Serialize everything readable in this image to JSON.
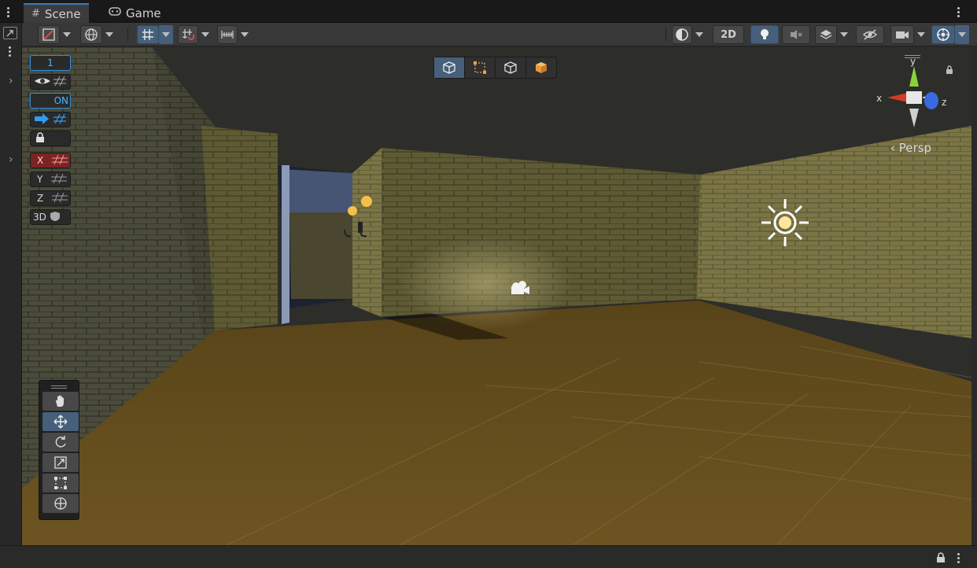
{
  "tabs": [
    {
      "label": "Scene",
      "icon": "grid-icon",
      "active": true
    },
    {
      "label": "Game",
      "icon": "gamepad-icon",
      "active": false
    }
  ],
  "toolbar": {
    "left": [
      "tool-handle-icon",
      "global-icon",
      "grid-snap-icon",
      "increment-snap-icon",
      "ruler-icon"
    ],
    "right": {
      "shading": "shading-mode-icon",
      "mode_2d": "2D",
      "lighting": "light-bulb-icon",
      "audio": "audio-mute-icon",
      "effects": "effects-icon",
      "hidden": "visibility-icon",
      "camera": "camera-icon",
      "gizmos": "gizmos-icon"
    }
  },
  "overlays": {
    "grid_value": "1",
    "snap_on": "ON",
    "x_label": "X",
    "y_label": "Y",
    "z_label": "Z",
    "label_3d": "3D"
  },
  "view_mode_icons": [
    "cube-icon",
    "rect-icon",
    "wire-cube-icon",
    "solid-cube-icon"
  ],
  "gizmo": {
    "x": "x",
    "y": "y",
    "z": "z",
    "projection": "Persp"
  },
  "tools": [
    "hand-icon",
    "move-icon",
    "rotate-icon",
    "scale-icon",
    "rect-tool-icon",
    "transform-icon"
  ],
  "colors": {
    "accent": "#3a79bb",
    "active_button": "#46607c",
    "axis_x": "#d02a2a",
    "axis_y": "#7ad12a",
    "axis_z": "#2a5ad0",
    "floor": "#6a5420",
    "wall": "#6b6538",
    "ceiling": "#2d2d2a"
  }
}
